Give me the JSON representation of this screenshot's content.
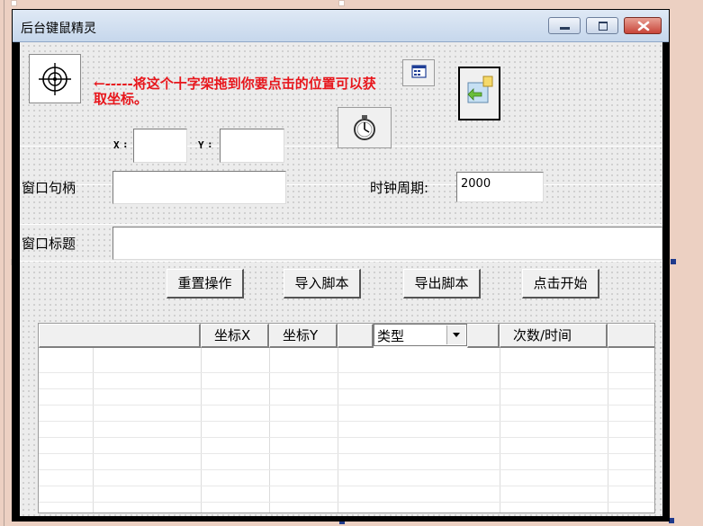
{
  "window": {
    "title": "后台键鼠精灵"
  },
  "picker": {
    "hint": "←-----将这个十字架拖到你要点击的位置可以获取坐标。"
  },
  "coords": {
    "x_label": "X",
    "y_label": "Y",
    "x_value": "",
    "y_value": ""
  },
  "handle": {
    "label": "窗口句柄",
    "value": ""
  },
  "timer": {
    "label": "时钟周期:",
    "value": "2000"
  },
  "title_field": {
    "label": "窗口标题",
    "value": ""
  },
  "actions": {
    "reset": "重置操作",
    "import": "导入脚本",
    "export": "导出脚本",
    "start": "点击开始"
  },
  "table": {
    "col_x": "坐标X",
    "col_y": "坐标Y",
    "type_selected": "类型",
    "col_count": "次数/时间"
  },
  "icons": {
    "crosshair": "crosshair-icon",
    "window_picker": "window-picker-icon",
    "stopwatch": "stopwatch-icon",
    "export_arrow": "export-arrow-icon"
  }
}
